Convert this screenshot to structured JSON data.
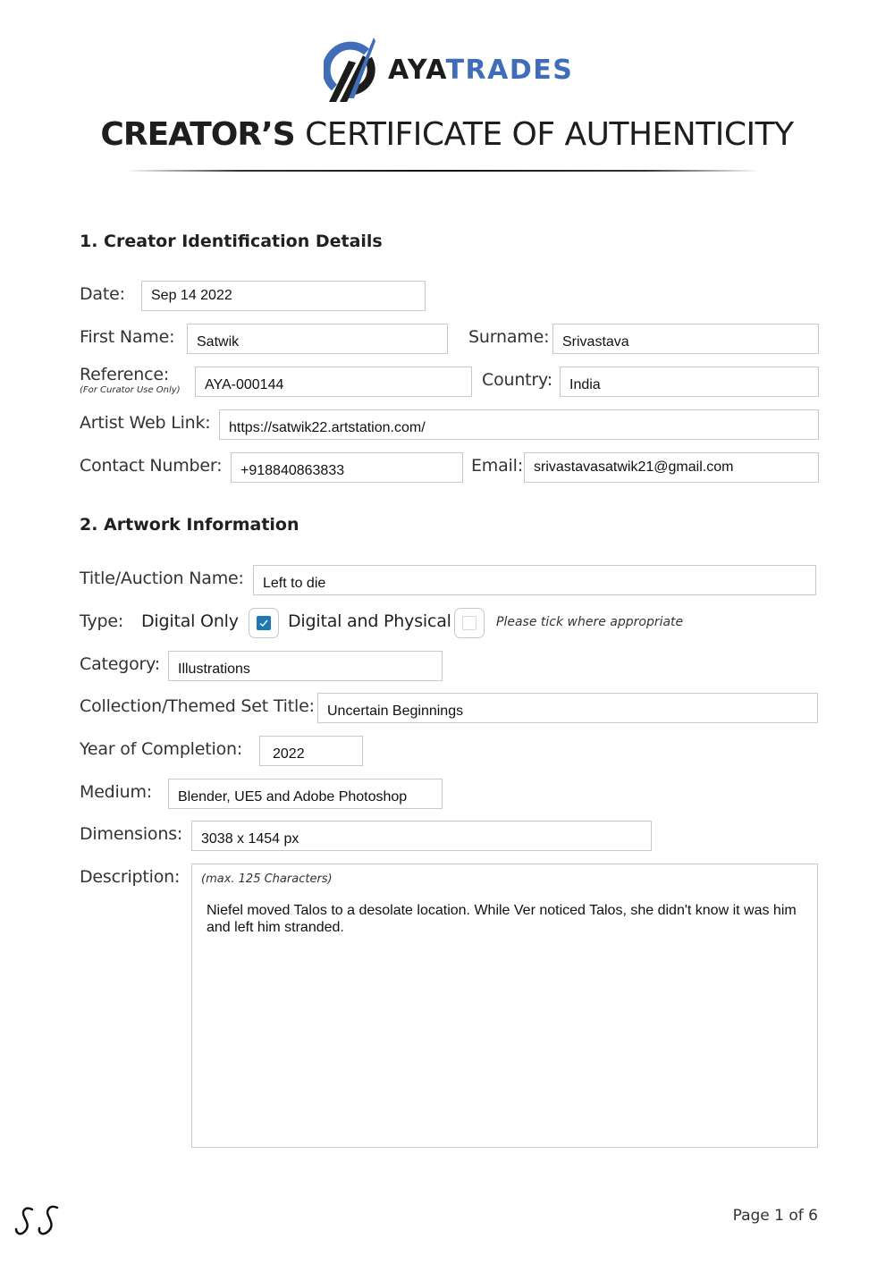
{
  "brand": {
    "name_part1": "AYA",
    "name_part2": "TRADES",
    "colors": {
      "dark": "#1c1c1c",
      "blue": "#3f6db8"
    }
  },
  "title": {
    "strong": "CREATOR’S",
    "rest": "CERTIFICATE OF AUTHENTICITY"
  },
  "section1": {
    "heading": "1. Creator Identification Details",
    "date": {
      "label": "Date:",
      "value": "Sep 14 2022"
    },
    "first_name": {
      "label": "First Name:",
      "value": "Satwik"
    },
    "surname": {
      "label": "Surname:",
      "value": "Srivastava"
    },
    "reference": {
      "label": "Reference:",
      "sublabel": "(For Curator Use Only)",
      "value": "AYA-000144"
    },
    "country": {
      "label": "Country:",
      "value": "India"
    },
    "web_link": {
      "label": "Artist Web Link:",
      "value": "https://satwik22.artstation.com/"
    },
    "contact": {
      "label": "Contact Number:",
      "value": "+918840863833"
    },
    "email": {
      "label": "Email:",
      "value": "srivastavasatwik21@gmail.com"
    }
  },
  "section2": {
    "heading": "2. Artwork Information",
    "title": {
      "label": "Title/Auction Name:",
      "value": "Left to die"
    },
    "type": {
      "label": "Type:",
      "options": [
        {
          "label": "Digital Only",
          "checked": true
        },
        {
          "label": "Digital and Physical",
          "checked": false
        }
      ],
      "hint": "Please tick where appropriate",
      "check_color": "#1f77b4"
    },
    "category": {
      "label": "Category:",
      "value": "Illustrations"
    },
    "collection": {
      "label": "Collection/Themed Set Title:",
      "value": "Uncertain Beginnings"
    },
    "year": {
      "label": "Year of Completion:",
      "value": "2022"
    },
    "medium": {
      "label": "Medium:",
      "value": "Blender, UE5 and Adobe Photoshop"
    },
    "dimensions": {
      "label": "Dimensions:",
      "value": "3038 x 1454 px"
    },
    "description": {
      "label": "Description:",
      "hint": "(max. 125 Characters)",
      "value": "Niefel moved Talos to a desolate location. While Ver noticed Talos, she didn't know it was him and left him stranded."
    }
  },
  "footer": {
    "signature": "SS",
    "page": "Page 1 of 6"
  }
}
